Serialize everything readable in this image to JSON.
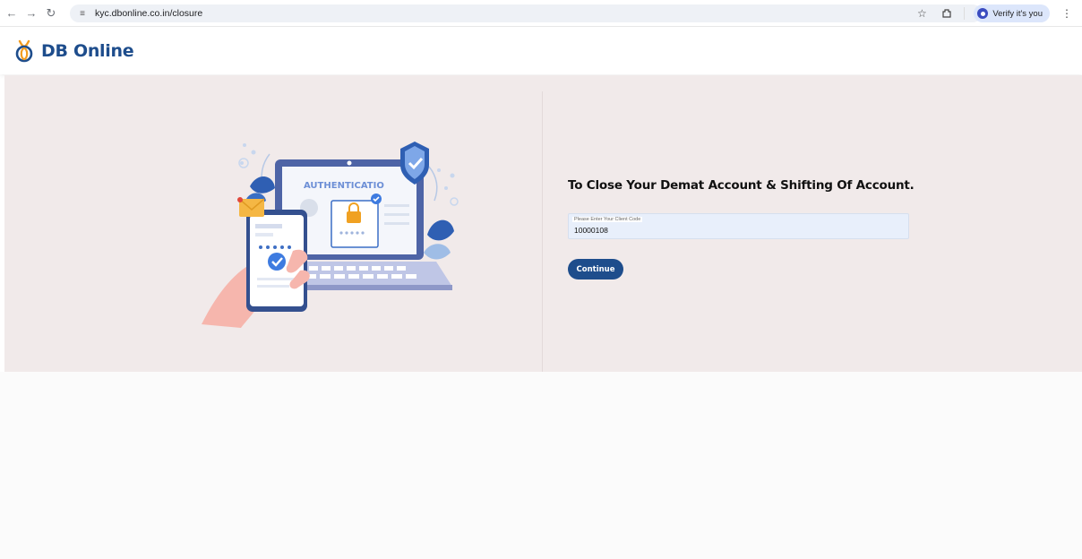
{
  "browser": {
    "url": "kyc.dbonline.co.in/closure",
    "profile_label": "Verify it's you"
  },
  "header": {
    "brand": "DB Online"
  },
  "hero": {
    "illustration_text": "AUTHENTICATIO",
    "title": "To Close Your Demat Account & Shifting Of Account.",
    "client_code": {
      "label": "Please Enter Your Client Code",
      "value": "10000108"
    },
    "continue_label": "Continue"
  },
  "colors": {
    "brand": "#1e4d8c",
    "hero_bg": "#f1eaea",
    "field_bg": "#e8effb",
    "accent_orange": "#f39c1f"
  },
  "icons": [
    "back-icon",
    "forward-icon",
    "reload-icon",
    "site-info-icon",
    "star-icon",
    "extensions-icon",
    "more-icon",
    "logo-icon"
  ]
}
